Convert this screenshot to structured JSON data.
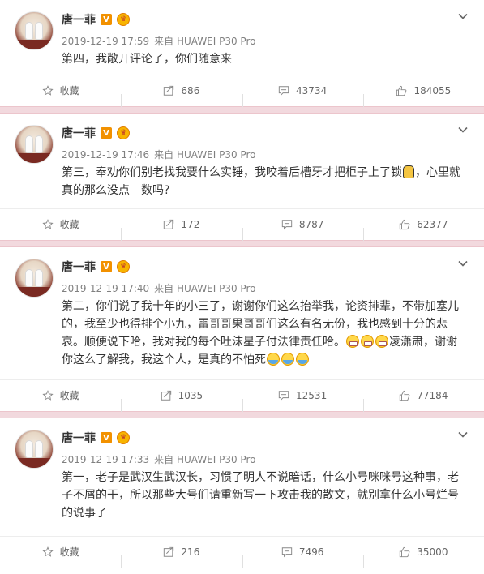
{
  "posts": [
    {
      "username": "唐一菲",
      "verified_badge": "V",
      "timestamp": "2019-12-19 17:59",
      "source": "来自 HUAWEI P30 Pro",
      "text": "第四，我敞开评论了，你们随意来",
      "actions": {
        "favorite": "收藏",
        "repost": "686",
        "comment": "43734",
        "like": "184055"
      }
    },
    {
      "username": "唐一菲",
      "verified_badge": "V",
      "timestamp": "2019-12-19 17:46",
      "source": "来自 HUAWEI P30 Pro",
      "text_before": "第三，奉劝你们别老找我要什么实锤，我咬着后槽牙才把柜子上了锁",
      "text_after": "，心里就真的那么没点　数吗?",
      "actions": {
        "favorite": "收藏",
        "repost": "172",
        "comment": "8787",
        "like": "62377"
      }
    },
    {
      "username": "唐一菲",
      "verified_badge": "V",
      "timestamp": "2019-12-19 17:40",
      "source": "来自 HUAWEI P30 Pro",
      "text_before": "第二，你们说了我十年的小三了，谢谢你们这么抬举我，论资排辈，不带加塞儿的，我至少也得排个小九，雷哥哥果哥哥们这么有名无份，我也感到十分的悲哀。顺便说下哈，我对我的每个吐沫星子付法律责任哈。",
      "text_middle": "凌潇肃，谢谢你这么了解我，我这个人，是真的不怕死",
      "actions": {
        "favorite": "收藏",
        "repost": "1035",
        "comment": "12531",
        "like": "77184"
      }
    },
    {
      "username": "唐一菲",
      "verified_badge": "V",
      "timestamp": "2019-12-19 17:33",
      "source": "来自 HUAWEI P30 Pro",
      "text": "第一，老子是武汉生武汉长，习惯了明人不说暗话，什么小号咪咪号这种事，老子不屑的干，所以那些大号们请重新写一下攻击我的散文，就别拿什么小号烂号的说事了",
      "actions": {
        "favorite": "收藏",
        "repost": "216",
        "comment": "7496",
        "like": "35000"
      }
    }
  ],
  "icons": {
    "favorite": "star-icon",
    "repost": "repost-icon",
    "comment": "comment-icon",
    "like": "thumbs-up-icon",
    "menu": "chevron-down-icon"
  },
  "colors": {
    "separator": "#f2d9de",
    "badge_v": "#f29100",
    "meta": "#808080"
  }
}
